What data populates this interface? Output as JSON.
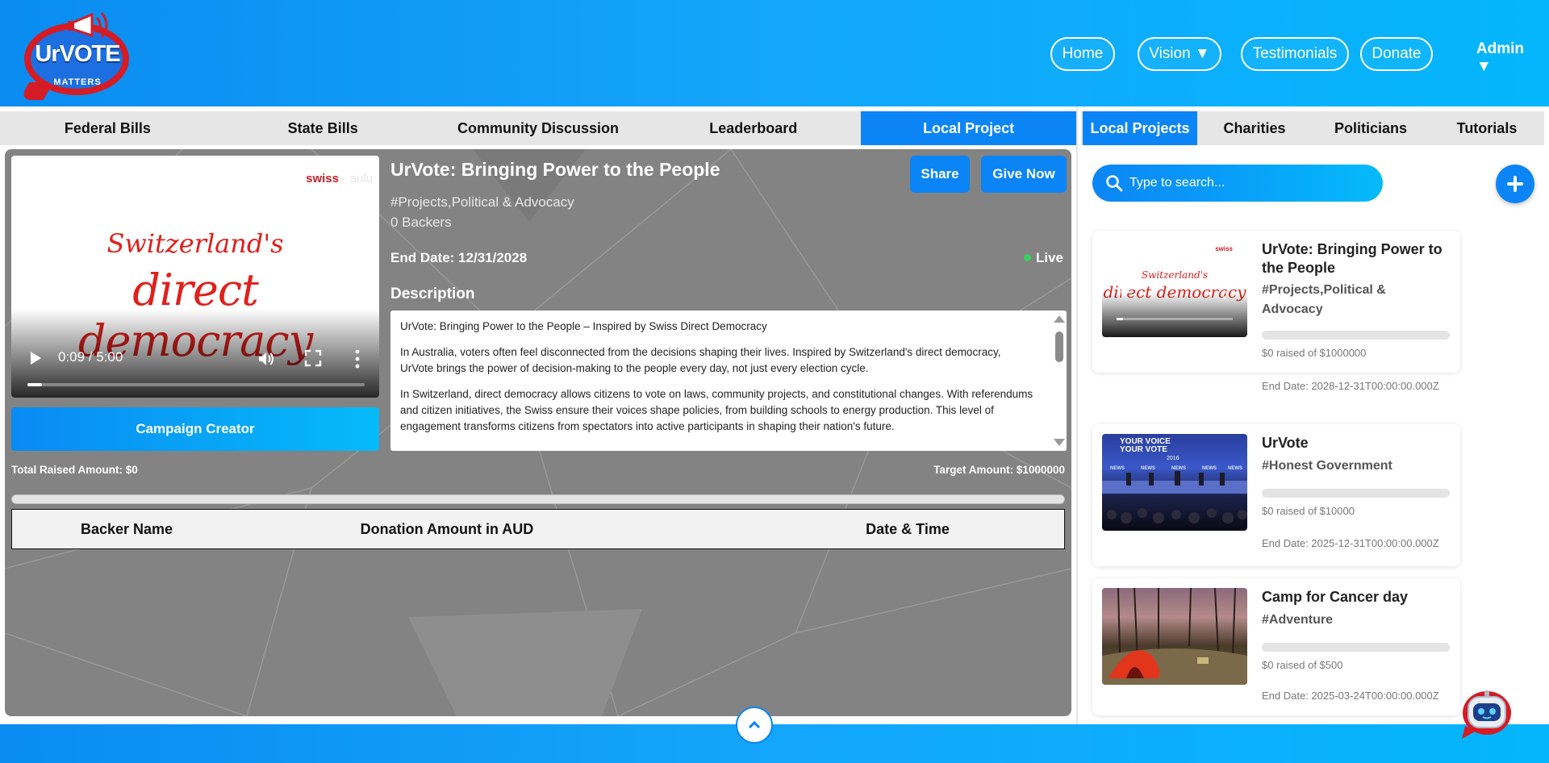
{
  "brand": {
    "logo_text": "UrVOTE",
    "logo_sub": "MATTERS"
  },
  "nav": {
    "home": "Home",
    "vision": "Vision ▼",
    "testimonials": "Testimonials",
    "donate": "Donate",
    "admin": "Admin ▼"
  },
  "left_tabs": [
    {
      "label": "Federal Bills"
    },
    {
      "label": "State Bills"
    },
    {
      "label": "Community Discussion"
    },
    {
      "label": "Leaderboard"
    },
    {
      "label": "Local Project"
    }
  ],
  "project": {
    "video": {
      "brand": "swiss",
      "brand_faint": "aulu",
      "title_line1": "Switzerland's",
      "title_line2": "direct democracy",
      "time": "0:09 / 5:00",
      "progress": 0.03
    },
    "creator_button": "Campaign Creator",
    "title": "UrVote: Bringing Power to the People",
    "tags": "#Projects,Political & Advocacy",
    "backers": "0 Backers",
    "end_date": "End Date: 12/31/2028",
    "status": "Live",
    "share": "Share",
    "give_now": "Give Now",
    "description_heading": "Description",
    "description": [
      "UrVote: Bringing Power to the People – Inspired by Swiss Direct Democracy",
      "In Australia, voters often feel disconnected from the decisions shaping their lives. Inspired by Switzerland's direct democracy, UrVote brings the power of decision-making to the people every day, not just every election cycle.",
      "In Switzerland, direct democracy allows citizens to vote on laws, community projects, and constitutional changes. With referendums and citizen initiatives, the Swiss ensure their voices shape policies, from building schools to energy production. This level of engagement transforms citizens from spectators into active participants in shaping their nation's future."
    ],
    "total_raised": "Total Raised Amount: $0",
    "target": "Target Amount: $1000000",
    "raised_fraction": 0,
    "table_headers": [
      "Backer Name",
      "Donation Amount in AUD",
      "Date & Time"
    ]
  },
  "right_tabs": [
    {
      "label": "Local Projects"
    },
    {
      "label": "Charities"
    },
    {
      "label": "Politicians"
    },
    {
      "label": "Tutorials"
    }
  ],
  "search": {
    "placeholder": "Type to search..."
  },
  "cards": [
    {
      "title": "UrVote: Bringing Power to the People",
      "tags": "#Projects,Political & Advocacy",
      "raised": "$0 raised of $1000000",
      "raised_fraction": 0,
      "end": "End Date: 2028-12-31T00:00:00.000Z"
    },
    {
      "title": "UrVote",
      "tags": "#Honest Government",
      "raised": "$0 raised of $10000",
      "raised_fraction": 0,
      "end": "End Date: 2025-12-31T00:00:00.000Z"
    },
    {
      "title": "Camp for Cancer day",
      "tags": "#Adventure",
      "raised": "$0 raised of $500",
      "raised_fraction": 0,
      "end": "End Date: 2025-03-24T00:00:00.000Z"
    }
  ],
  "card_thumb1": {
    "brand": "swiss",
    "line1": "Switzerland's",
    "line2": "direct democracy"
  },
  "card_thumb2": {
    "line1": "YOUR VOICE",
    "line2": "YOUR VOTE",
    "year": "2016",
    "news": "NEWS"
  },
  "colors": {
    "accent": "#0b85f6",
    "header_start": "#0a8cf0",
    "header_end": "#04b6fb",
    "live": "#34d058",
    "logo_red": "#d51c25"
  }
}
